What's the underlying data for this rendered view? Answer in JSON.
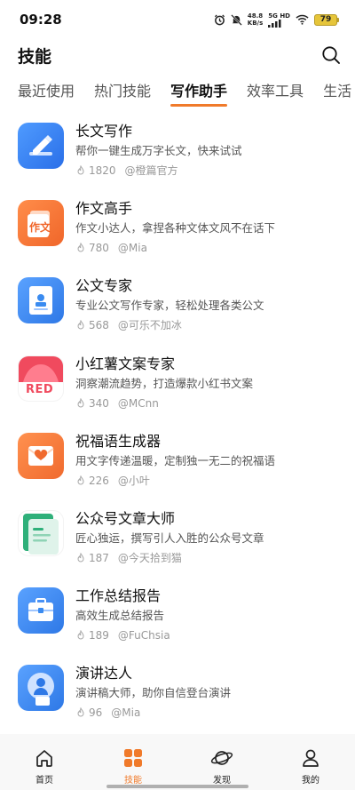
{
  "status_bar": {
    "time": "09:28",
    "speed_value": "48.8",
    "speed_unit": "KB/s",
    "network": "5G HD",
    "battery": "79",
    "icons": [
      "alarm-icon",
      "mute-icon",
      "signal-icon",
      "wifi-icon",
      "battery-icon"
    ]
  },
  "header": {
    "title": "技能",
    "search_icon": "search-icon"
  },
  "tabs": [
    {
      "label": "最近使用",
      "active": false
    },
    {
      "label": "热门技能",
      "active": false
    },
    {
      "label": "写作助手",
      "active": true
    },
    {
      "label": "效率工具",
      "active": false
    },
    {
      "label": "生活",
      "active": false
    }
  ],
  "skills": [
    {
      "title": "长文写作",
      "desc": "帮你一键生成万字长文，快来试试",
      "count": "1820",
      "author": "@橙篇官方",
      "icon": "pen-icon",
      "icon_color": "#2f7ff0"
    },
    {
      "title": "作文高手",
      "desc": "作文小达人，拿捏各种文体文风不在话下",
      "count": "780",
      "author": "@Mia",
      "icon": "essay-icon",
      "icon_text": "作文",
      "icon_color": "#f5763a"
    },
    {
      "title": "公文专家",
      "desc": "专业公文写作专家，轻松处理各类公文",
      "count": "568",
      "author": "@可乐不加冰",
      "icon": "document-icon",
      "icon_color": "#3a8bf0"
    },
    {
      "title": "小红薯文案专家",
      "desc": "洞察潮流趋势，打造爆款小红书文案",
      "count": "340",
      "author": "@MCnn",
      "icon": "red-note-icon",
      "icon_text": "RED",
      "icon_color": "#f04a5e"
    },
    {
      "title": "祝福语生成器",
      "desc": "用文字传递温暖，定制独一无二的祝福语",
      "count": "226",
      "author": "@小叶",
      "icon": "heart-letter-icon",
      "icon_color": "#f57a3a"
    },
    {
      "title": "公众号文章大师",
      "desc": "匠心独运，撰写引人入胜的公众号文章",
      "count": "187",
      "author": "@今天拾到猫",
      "icon": "article-icon",
      "icon_color": "#2fb07a"
    },
    {
      "title": "工作总结报告",
      "desc": "高效生成总结报告",
      "count": "189",
      "author": "@FuChsia",
      "icon": "briefcase-icon",
      "icon_color": "#3a8bf0"
    },
    {
      "title": "演讲达人",
      "desc": "演讲稿大师，助你自信登台演讲",
      "count": "96",
      "author": "@Mia",
      "icon": "speech-icon",
      "icon_color": "#3a8bf0"
    }
  ],
  "bottom_nav": [
    {
      "label": "首页",
      "icon": "home-icon",
      "active": false
    },
    {
      "label": "技能",
      "icon": "skills-grid-icon",
      "active": true
    },
    {
      "label": "发现",
      "icon": "planet-icon",
      "active": false
    },
    {
      "label": "我的",
      "icon": "profile-icon",
      "active": false
    }
  ],
  "colors": {
    "accent": "#f07a2a",
    "muted": "#999999"
  }
}
